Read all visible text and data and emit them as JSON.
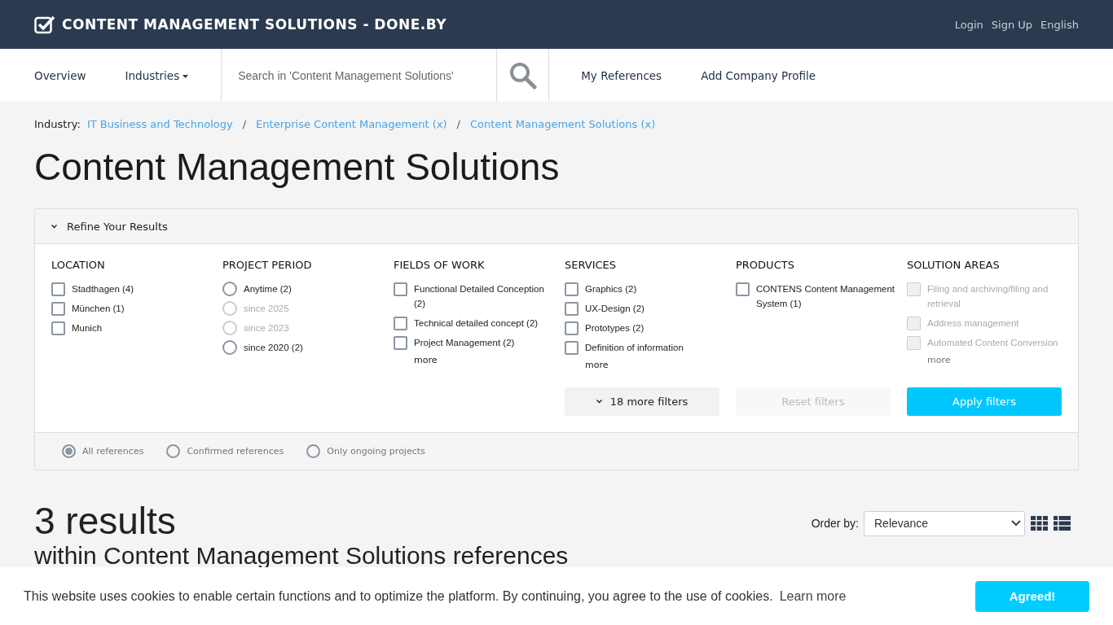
{
  "header": {
    "title": "CONTENT MANAGEMENT SOLUTIONS - DONE.BY",
    "links": [
      "Login",
      "Sign Up",
      "English"
    ]
  },
  "nav": {
    "items": [
      {
        "label": "Overview",
        "kind": "link"
      },
      {
        "label": "Industries",
        "kind": "dropdown"
      }
    ],
    "search": {
      "placeholder": "Search in 'Content Management Solutions'"
    },
    "links": [
      "My References",
      "Add Company Profile"
    ]
  },
  "breadcrumb": {
    "label": "Industry:",
    "separator": "/",
    "items": [
      "IT Business and Technology",
      "Enterprise Content Management (x)",
      "Content Management Solutions (x)"
    ]
  },
  "page_title": "Content Management Solutions",
  "refine": {
    "title": "Refine Your Results",
    "expanded": true,
    "groups": [
      {
        "title": "LOCATION",
        "kind": "checkbox",
        "items": [
          {
            "label": "Stadthagen (4)",
            "checked": false,
            "disabled": false
          },
          {
            "label": "München (1)",
            "checked": false,
            "disabled": false
          },
          {
            "label": "Munich",
            "checked": false,
            "disabled": false
          }
        ]
      },
      {
        "title": "PROJECT PERIOD",
        "kind": "radio",
        "items": [
          {
            "label": "Anytime (2)",
            "selected": false,
            "disabled": false
          },
          {
            "label": "since 2025",
            "selected": false,
            "disabled": true
          },
          {
            "label": "since 2023",
            "selected": false,
            "disabled": true
          },
          {
            "label": "since 2020 (2)",
            "selected": false,
            "disabled": false
          }
        ]
      },
      {
        "title": "FIELDS OF WORK",
        "kind": "checkbox",
        "items": [
          {
            "label": "Functional Detailed Conception (2)",
            "checked": false,
            "disabled": false
          },
          {
            "label": "Technical detailed concept (2)",
            "checked": false,
            "disabled": false
          },
          {
            "label": "Project Management (2)",
            "checked": false,
            "disabled": false
          }
        ],
        "more": "more"
      },
      {
        "title": "SERVICES",
        "kind": "checkbox",
        "items": [
          {
            "label": "Graphics (2)",
            "checked": false,
            "disabled": false
          },
          {
            "label": "UX-Design (2)",
            "checked": false,
            "disabled": false
          },
          {
            "label": "Prototypes (2)",
            "checked": false,
            "disabled": false
          },
          {
            "label": "Definition of information",
            "checked": false,
            "disabled": false
          }
        ],
        "more": "more"
      },
      {
        "title": "PRODUCTS",
        "kind": "checkbox",
        "items": [
          {
            "label": "CONTENS Content Management System (1)",
            "checked": false,
            "disabled": false
          }
        ]
      },
      {
        "title": "SOLUTION AREAS",
        "kind": "checkbox",
        "items": [
          {
            "label": "Filing and archiving/filing and retrieval",
            "checked": false,
            "disabled": true
          },
          {
            "label": "Address management",
            "checked": false,
            "disabled": true
          },
          {
            "label": "Automated Content Conversion",
            "checked": false,
            "disabled": true
          }
        ],
        "more": "more"
      }
    ],
    "more_filters": "18 more filters",
    "reset": {
      "label": "Reset filters",
      "disabled": true
    },
    "apply": "Apply filters",
    "scope": [
      {
        "label": "All references",
        "selected": true
      },
      {
        "label": "Confirmed references",
        "selected": false
      },
      {
        "label": "Only ongoing projects",
        "selected": false
      }
    ]
  },
  "results": {
    "count": "3 results",
    "subtitle": "within Content Management Solutions references",
    "order_label": "Order by:",
    "order_value": "Relevance"
  },
  "cookie": {
    "text": "This website uses cookies to enable certain functions and to optimize the platform. By continuing, you agree to the use of cookies.",
    "link": "Learn more",
    "button": "Agreed!"
  }
}
